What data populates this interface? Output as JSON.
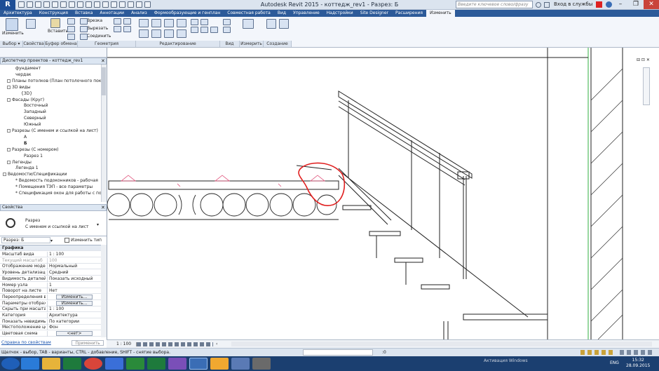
{
  "app": {
    "title": "Autodesk Revit 2015 -   коттедж_rev1 - Разрез: Б",
    "menu_button": "R",
    "search_placeholder": "Введите ключевое слово/фразу",
    "sign_in": "Вход в службы",
    "window_controls": [
      "–",
      "❐",
      "✕"
    ]
  },
  "tabs": [
    "Архитектура",
    "Конструкция",
    "Вставка",
    "Аннотации",
    "Анализ",
    "Формообразующие и генплан",
    "Совместная работа",
    "Вид",
    "Управление",
    "Надстройки",
    "Site Designer",
    "Расширения",
    "Изменить"
  ],
  "active_tab": "Изменить",
  "ribbon": {
    "groups": [
      "Выбор ▾",
      "Свойства",
      "Буфер обмена",
      "Геометрия",
      "Редактирование",
      "Вид",
      "Измерить",
      "Создание"
    ],
    "modify_label": "Изменить",
    "paste_label": "Вставить",
    "geometry_items": [
      "Врезка",
      "Вырезать",
      "Соединить"
    ]
  },
  "project_browser": {
    "title": "Диспетчер проектов - коттедж_rev1",
    "items": [
      "фундамент",
      "чердак",
      "Планы потолков (План потолочного покрыт",
      "3D виды",
      "{3D}",
      "Фасады (Круг)",
      "Восточный",
      "Западный",
      "Северный",
      "Южный",
      "Разрезы (С именем и ссылкой на лист)",
      "А",
      "Б",
      "Разрезы (С номером)",
      "Разрез 1",
      "Легенды",
      "Легенда 1",
      "Ведомости/Спецификации",
      "* Ведомость подоконников - рабочая",
      "* Помещения ТЭП - все параметры",
      "* Спецификация окон для работы с подокон"
    ]
  },
  "properties": {
    "title": "Свойства",
    "type_name": "Разрез",
    "type_sub": "С именем и ссылкой на лист",
    "instance": "Разрез: Б",
    "edit_type": "Изменить тип",
    "section": "Графика",
    "rows": [
      {
        "k": "Масштаб вида",
        "v": "1 : 100"
      },
      {
        "k": "Текущий масштаб",
        "v": "100"
      },
      {
        "k": "Отображение модели",
        "v": "Нормальный"
      },
      {
        "k": "Уровень детализации",
        "v": "Средний"
      },
      {
        "k": "Видимость деталей",
        "v": "Показать исходный"
      },
      {
        "k": "Номер узла",
        "v": "1"
      },
      {
        "k": "Поворот на листе",
        "v": "Нет"
      },
      {
        "k": "Переопределения ви...",
        "v": "Изменить..."
      },
      {
        "k": "Параметры отображ...",
        "v": "Изменить..."
      },
      {
        "k": "Скрыть при масштаб...",
        "v": "1 : 100"
      },
      {
        "k": "Категория",
        "v": "Архитектура"
      },
      {
        "k": "Показать невидимые...",
        "v": "По категории"
      },
      {
        "k": "Местоположение це...",
        "v": "Фон"
      },
      {
        "k": "Цветовая схема",
        "v": "<нет>"
      }
    ],
    "help_link": "Справка по свойствам",
    "apply": "Применить"
  },
  "view_control": {
    "scale": "1 : 100"
  },
  "status": {
    "text": "Щелчок - выбор, TAB - варианты, CTRL - добавление, SHIFT - снятие выбора.",
    "coord": ":0",
    "activate": "Активация Windows"
  },
  "taskbar": {
    "lang": "ENG",
    "time": "15:32",
    "date": "28.09.2015"
  },
  "colors": {
    "accent": "#2c5a99",
    "highlight_circle": "#e02020",
    "section_mark": "#e0507a",
    "level_line": "#30b040"
  }
}
